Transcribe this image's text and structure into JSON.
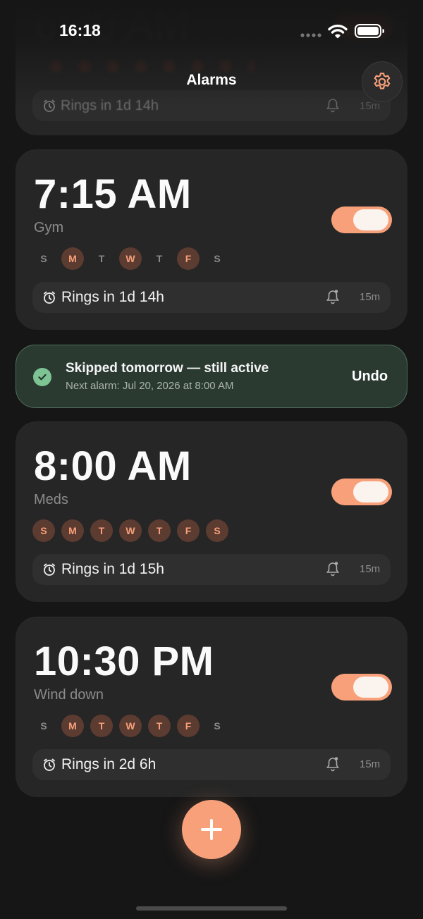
{
  "status_bar": {
    "time": "16:18"
  },
  "header": {
    "title": "Alarms",
    "settings_icon": "gear-icon"
  },
  "ghost_card": {
    "time": "6:30 AM",
    "ring_text": "Rings in 1d 14h",
    "minutes": "15m"
  },
  "alarms": [
    {
      "time": "7:15 AM",
      "label": "Gym",
      "enabled": true,
      "days": [
        {
          "letter": "S",
          "on": false
        },
        {
          "letter": "M",
          "on": true
        },
        {
          "letter": "T",
          "on": false
        },
        {
          "letter": "W",
          "on": true
        },
        {
          "letter": "T",
          "on": false
        },
        {
          "letter": "F",
          "on": true
        },
        {
          "letter": "S",
          "on": false
        }
      ],
      "ring_text": "Rings in 1d 14h",
      "minutes": "15m"
    },
    {
      "time": "8:00 AM",
      "label": "Meds",
      "enabled": true,
      "days": [
        {
          "letter": "S",
          "on": true
        },
        {
          "letter": "M",
          "on": true
        },
        {
          "letter": "T",
          "on": true
        },
        {
          "letter": "W",
          "on": true
        },
        {
          "letter": "T",
          "on": true
        },
        {
          "letter": "F",
          "on": true
        },
        {
          "letter": "S",
          "on": true
        }
      ],
      "ring_text": "Rings in 1d 15h",
      "minutes": "15m"
    },
    {
      "time": "10:30 PM",
      "label": "Wind down",
      "enabled": true,
      "days": [
        {
          "letter": "S",
          "on": false
        },
        {
          "letter": "M",
          "on": true
        },
        {
          "letter": "T",
          "on": true
        },
        {
          "letter": "W",
          "on": true
        },
        {
          "letter": "T",
          "on": true
        },
        {
          "letter": "F",
          "on": true
        },
        {
          "letter": "S",
          "on": false
        }
      ],
      "ring_text": "Rings in 2d 6h",
      "minutes": "15m"
    }
  ],
  "toast": {
    "title": "Skipped tomorrow — still active",
    "subtitle": "Next alarm: Jul 20, 2026 at 8:00 AM",
    "action": "Undo"
  },
  "colors": {
    "accent": "#f7a07a",
    "card": "#262626",
    "background": "#161616",
    "success": "#7dc394"
  }
}
